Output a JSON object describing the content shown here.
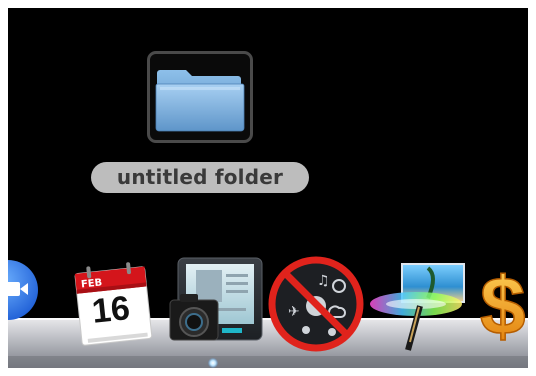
{
  "desktop": {
    "folder": {
      "label": "untitled folder",
      "icon": "folder-icon",
      "selected": true
    }
  },
  "dock": {
    "items": [
      {
        "icon": "facetime-icon",
        "running": false
      },
      {
        "icon": "ical-icon",
        "month": "FEB",
        "day": "16",
        "running": false
      },
      {
        "icon": "photo-booth-icon",
        "running": true
      },
      {
        "icon": "dashboard-icon",
        "running": false
      },
      {
        "icon": "front-row-icon",
        "running": false
      },
      {
        "icon": "dollar-icon",
        "running": false
      }
    ]
  },
  "colors": {
    "desktop": "#000000",
    "folder_blue": "#6fa6d6",
    "label_bg": "#bdbdbd",
    "no_sign_red": "#e0231c"
  }
}
